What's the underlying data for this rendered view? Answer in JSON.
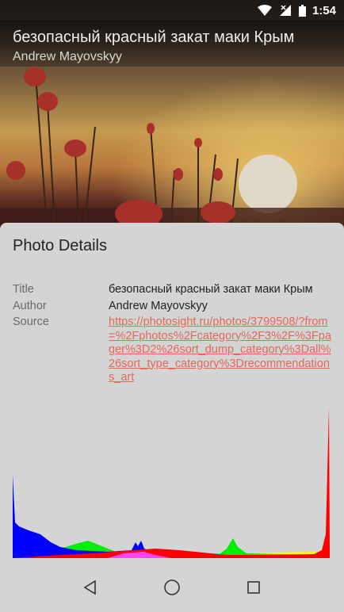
{
  "status": {
    "time": "1:54",
    "icons": [
      "wifi-icon",
      "signal-icon",
      "battery-icon"
    ]
  },
  "photo": {
    "title": "безопасный красный закат маки Крым",
    "author": "Andrew Mayovskyy"
  },
  "sheet": {
    "heading": "Photo Details",
    "rows": [
      {
        "label": "Title",
        "value": "безопасный красный закат маки Крым"
      },
      {
        "label": "Author",
        "value": "Andrew Mayovskyy"
      },
      {
        "label": "Source",
        "value": "https://photosight.ru/photos/3799508/?from=%2Fphotos%2Fcategory%2F3%2F%3Fpager%3D2%26sort_dump_category%3Dall%26sort_type_category%3Drecommendations_art"
      }
    ],
    "histogram": {
      "channels": [
        "blue",
        "green",
        "red",
        "magenta",
        "cyan",
        "yellow"
      ]
    }
  },
  "nav": {
    "icons": [
      "back-icon",
      "home-icon",
      "recents-icon"
    ]
  },
  "colors": {
    "sheet_bg": "#d4d4d4",
    "link": "#e2685a",
    "label": "#6a6a6a"
  }
}
